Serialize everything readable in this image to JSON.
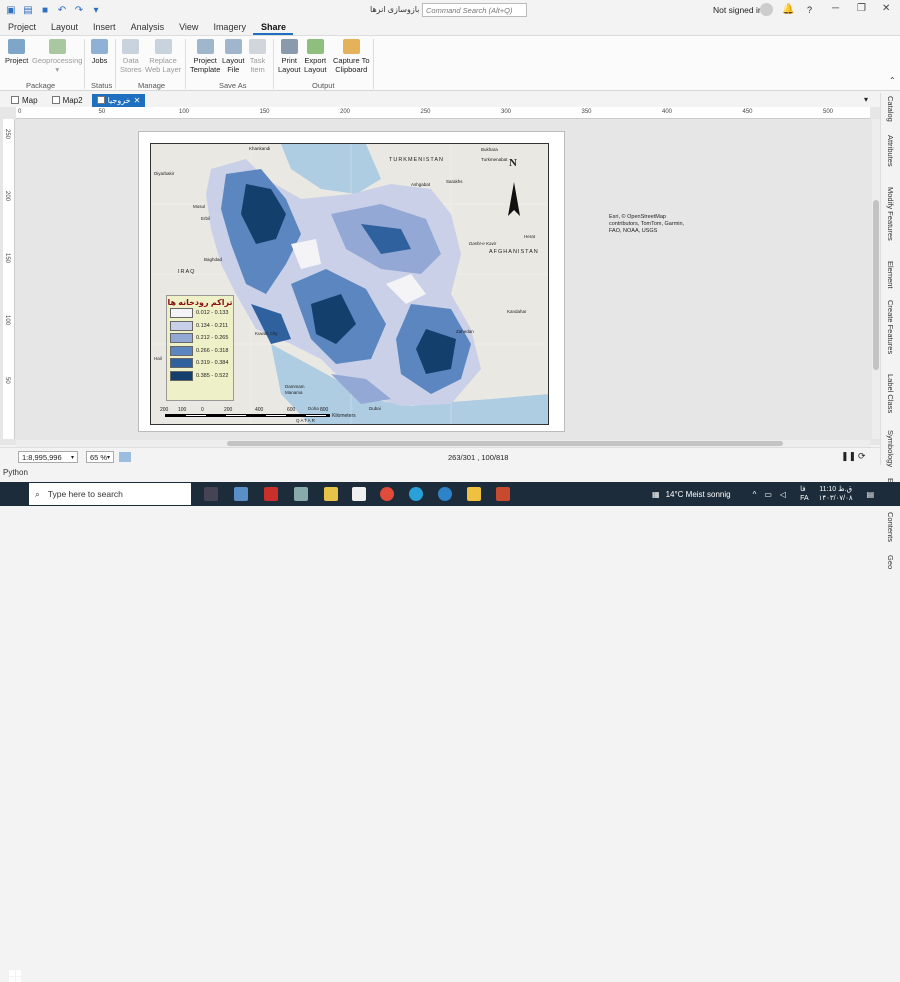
{
  "titlebar": {
    "title": "بازوسازی انرها",
    "search_placeholder": "Command Search (Alt+Q)",
    "signin": "Not signed in",
    "help": "?"
  },
  "ribbon_tabs": [
    "Project",
    "Layout",
    "Insert",
    "Analysis",
    "View",
    "Imagery",
    "Share"
  ],
  "active_tab": "Share",
  "ribbon": {
    "project": "Project",
    "geoprocessing": "Geoprocessing",
    "group_package": "Package",
    "jobs": "Jobs",
    "group_status": "Status",
    "data_stores": "Data\nStores",
    "replace_web_layer": "Replace\nWeb Layer",
    "group_manage": "Manage",
    "project_template": "Project\nTemplate",
    "layout_file": "Layout\nFile",
    "task_item": "Task\nItem",
    "group_save_as": "Save As",
    "print_layout": "Print\nLayout",
    "export_layout": "Export\nLayout",
    "capture_clipboard": "Capture To\nClipboard",
    "group_output": "Output"
  },
  "view_tabs": [
    {
      "label": "Map"
    },
    {
      "label": "Map2"
    },
    {
      "label": "خروجیا"
    }
  ],
  "ruler_h": [
    "0",
    "50",
    "100",
    "150",
    "200",
    "250",
    "300",
    "350",
    "400",
    "450",
    "500"
  ],
  "ruler_v": [
    "250",
    "200",
    "150",
    "100",
    "50"
  ],
  "map": {
    "labels": {
      "turkmenistan": "TURKMENISTAN",
      "afghanistan": "AFGHANISTAN",
      "iraq": "IRAQ",
      "north": "N",
      "bukhara": "Bukhara",
      "turkmenabat": "Turkmenabat",
      "ashgabat": "Ashgabat",
      "sarakhs": "Sarakhs",
      "kandahar": "Khankandi",
      "mosul": "Mosul",
      "baghdad": "Baghdad",
      "kuwait": "Kuwait City",
      "dammam": "Dammam",
      "manama": "Manama",
      "doha": "Doha",
      "qatar": "QATAR",
      "dubai": "Dubai",
      "diyarbakir": "Diyarbakir",
      "erbil": "Erbil",
      "herat": "Herat",
      "kandahar_af": "Kandahar",
      "zahedan": "Zahedan",
      "hai": "Hail",
      "dasht": "Dasht-e Kavir"
    },
    "scale_numbers": [
      "200",
      "100",
      "0",
      "200",
      "400",
      "600",
      "800"
    ],
    "scale_unit": "Kilometers"
  },
  "legend": {
    "title": "تراکم رودخانه ها",
    "classes": [
      {
        "label": "0.012 - 0.133",
        "color": "#f4f4f7"
      },
      {
        "label": "0.134 - 0.211",
        "color": "#c8cfe8"
      },
      {
        "label": "0.212 - 0.265",
        "color": "#93a8d4"
      },
      {
        "label": "0.266 - 0.318",
        "color": "#5b86c0"
      },
      {
        "label": "0.319 - 0.384",
        "color": "#2e619e"
      },
      {
        "label": "0.385 - 0.522",
        "color": "#123f6c"
      }
    ]
  },
  "credits": "Esri, © OpenStreetMap contributors, TomTom, Garmin, FAO, NOAA, USGS",
  "right_panes": [
    "Catalog",
    "Attributes",
    "Modify Features",
    "Element",
    "Create Features",
    "Label Class",
    "Symbology",
    "Export",
    "Contents",
    "Geo"
  ],
  "status": {
    "scale": "1:8,995,996",
    "zoom": "65 %",
    "coords": "263/301 , 100/818"
  },
  "python": "Python",
  "taskbar": {
    "search": "Type here to search",
    "weather": "14°C  Meist sonnig",
    "lang_a": "FA",
    "lang_b": "فا",
    "time": "11:10 ق.ظ",
    "date": "۱۴۰۳/۰۷/۰۸"
  }
}
